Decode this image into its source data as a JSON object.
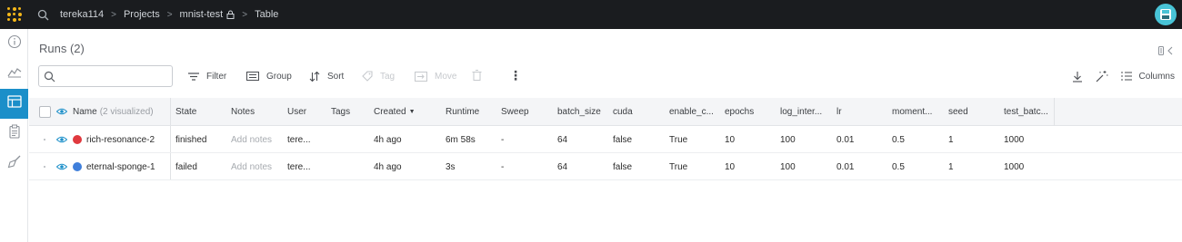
{
  "topbar": {
    "breadcrumbs": [
      "tereka114",
      "Projects",
      "mnist-test",
      "Table"
    ],
    "separator": ">"
  },
  "sidebar": {
    "items": [
      {
        "icon": "info-icon",
        "active": false
      },
      {
        "icon": "chart-icon",
        "active": false
      },
      {
        "icon": "table-icon",
        "active": true
      },
      {
        "icon": "report-icon",
        "active": false
      },
      {
        "icon": "sweep-brush-icon",
        "active": false
      }
    ]
  },
  "main": {
    "title": "Runs (2)",
    "search": {
      "value": "",
      "placeholder": ""
    },
    "toolbar": {
      "filter": "Filter",
      "group": "Group",
      "sort": "Sort",
      "tag": "Tag",
      "move": "Move",
      "columns": "Columns",
      "more": "⋮"
    }
  },
  "table": {
    "name_header": "Name",
    "visualized": "(2 visualized)",
    "columns": [
      "State",
      "Notes",
      "User",
      "Tags",
      "Created",
      "Runtime",
      "Sweep",
      "batch_size",
      "cuda",
      "enable_c...",
      "epochs",
      "log_inter...",
      "lr",
      "moment...",
      "seed",
      "test_batc..."
    ],
    "rows": [
      {
        "name": "rich-resonance-2",
        "color": "#e0393e",
        "cells": [
          "finished",
          "Add notes",
          "tere...",
          "",
          "4h ago",
          "6m 58s",
          "-",
          "64",
          "false",
          "True",
          "10",
          "100",
          "0.01",
          "0.5",
          "1",
          "1000"
        ]
      },
      {
        "name": "eternal-sponge-1",
        "color": "#3f7fdb",
        "cells": [
          "failed",
          "Add notes",
          "tere...",
          "",
          "4h ago",
          "3s",
          "-",
          "64",
          "false",
          "True",
          "10",
          "100",
          "0.01",
          "0.5",
          "1",
          "1000"
        ]
      }
    ]
  },
  "colors": {
    "topbar": "#1a1c1f",
    "accent": "#1b8fc9",
    "logo": "#f5b719"
  }
}
